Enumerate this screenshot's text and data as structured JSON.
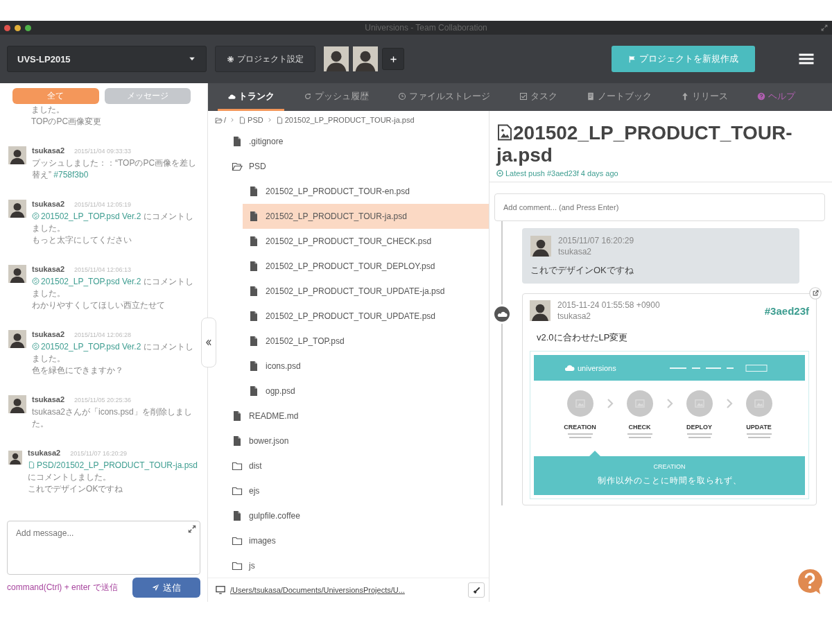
{
  "window": {
    "title": "Universions - Team Collaboration"
  },
  "toolbar": {
    "project": "UVS-LP2015",
    "settings_button": "プロジェクト設定",
    "new_project_button": "プロジェクトを新規作成"
  },
  "feed": {
    "filters": [
      {
        "label": "全て",
        "selected": true
      },
      {
        "label": "メッセージ",
        "selected": false
      }
    ],
    "items": [
      {
        "kind": "partial",
        "parts": [
          {
            "kind": "text",
            "text": "ました。"
          }
        ],
        "note": "TOPのPC画像変更"
      },
      {
        "kind": "entry",
        "user": "tsukasa2",
        "time": "2015/11/04 09:33:33",
        "parts": [
          {
            "kind": "text",
            "text": "プッシュしました：：“TOPのPC画像を差し替え” "
          },
          {
            "kind": "link",
            "text": "#758f3b0"
          }
        ]
      },
      {
        "kind": "entry",
        "user": "tsukasa2",
        "time": "2015/11/04 12:05:19",
        "parts": [
          {
            "kind": "version_link",
            "text": "201502_LP_TOP.psd Ver.2"
          },
          {
            "kind": "text",
            "text": " にコメントしました。"
          }
        ],
        "note": "もっと太字にしてください"
      },
      {
        "kind": "entry",
        "user": "tsukasa2",
        "time": "2015/11/04 12:06:13",
        "parts": [
          {
            "kind": "version_link",
            "text": "201502_LP_TOP.psd Ver.2"
          },
          {
            "kind": "text",
            "text": " にコメントしました。"
          }
        ],
        "note": "わかりやすくしてほしい西立たせて"
      },
      {
        "kind": "entry",
        "user": "tsukasa2",
        "time": "2015/11/04 12:06:28",
        "parts": [
          {
            "kind": "version_link",
            "text": "201502_LP_TOP.psd Ver.2"
          },
          {
            "kind": "text",
            "text": " にコメントしました。"
          }
        ],
        "note": "色を緑色にできますか？"
      },
      {
        "kind": "entry",
        "user": "tsukasa2",
        "time": "2015/11/05 20:25:36",
        "parts": [
          {
            "kind": "text",
            "text": "tsukasa2さんが「icons.psd」を削除しました。"
          }
        ]
      },
      {
        "kind": "entry",
        "user": "tsukasa2",
        "time": "2015/11/07 16:20:29",
        "parts": [
          {
            "kind": "file_link",
            "text": "PSD/201502_LP_PRODUCT_TOUR-ja.psd"
          },
          {
            "kind": "text",
            "text": " にコメントしました。"
          }
        ],
        "note": "これでデザインOKですね"
      }
    ],
    "message": {
      "placeholder": "Add message..."
    },
    "hint": "command(Ctrl) + enter で送信",
    "send_button": "送信"
  },
  "tabs": [
    {
      "label": "トランク",
      "kind": "normal",
      "selected": true
    },
    {
      "label": "プッシュ履歴",
      "kind": "normal",
      "selected": false
    },
    {
      "label": "ファイルストレージ",
      "kind": "normal",
      "selected": false
    },
    {
      "label": "タスク",
      "kind": "normal",
      "selected": false
    },
    {
      "label": "ノートブック",
      "kind": "normal",
      "selected": false
    },
    {
      "label": "リリース",
      "kind": "normal",
      "selected": false
    },
    {
      "label": "ヘルプ",
      "kind": "help",
      "selected": false
    }
  ],
  "breadcrumb": [
    "/",
    "PSD",
    "201502_LP_PRODUCT_TOUR-ja.psd"
  ],
  "tree": [
    {
      "kind": "file",
      "name": ".gitignore",
      "selected": false
    },
    {
      "kind": "folder",
      "name": "PSD",
      "expanded": true,
      "selected": false,
      "children": [
        {
          "kind": "file",
          "name": "201502_LP_PRODUCT_TOUR-en.psd",
          "selected": false
        },
        {
          "kind": "file",
          "name": "201502_LP_PRODUCT_TOUR-ja.psd",
          "selected": true
        },
        {
          "kind": "file",
          "name": "201502_LP_PRODUCT_TOUR_CHECK.psd",
          "selected": false
        },
        {
          "kind": "file",
          "name": "201502_LP_PRODUCT_TOUR_DEPLOY.psd",
          "selected": false
        },
        {
          "kind": "file",
          "name": "201502_LP_PRODUCT_TOUR_UPDATE-ja.psd",
          "selected": false
        },
        {
          "kind": "file",
          "name": "201502_LP_PRODUCT_TOUR_UPDATE.psd",
          "selected": false
        },
        {
          "kind": "file",
          "name": "201502_LP_TOP.psd",
          "selected": false
        },
        {
          "kind": "file",
          "name": "icons.psd",
          "selected": false
        },
        {
          "kind": "file",
          "name": "ogp.psd",
          "selected": false
        }
      ]
    },
    {
      "kind": "file",
      "name": "README.md",
      "selected": false
    },
    {
      "kind": "file",
      "name": "bower.json",
      "selected": false
    },
    {
      "kind": "folder",
      "name": "dist",
      "expanded": false,
      "selected": false
    },
    {
      "kind": "folder",
      "name": "ejs",
      "expanded": false,
      "selected": false
    },
    {
      "kind": "file",
      "name": "gulpfile.coffee",
      "selected": false
    },
    {
      "kind": "folder",
      "name": "images",
      "expanded": false,
      "selected": false
    },
    {
      "kind": "folder",
      "name": "js",
      "expanded": false,
      "selected": false
    }
  ],
  "path": "/Users/tsukasa/Documents/UniversionsProjects/U...",
  "file": {
    "title": "201502_LP_PRODUCT_TOUR-ja.psd",
    "latest_push": "Latest push #3aed23f 4 days ago",
    "comment": {
      "placeholder": "Add comment... (and Press Enter)"
    }
  },
  "timeline": [
    {
      "kind": "comment",
      "time": "2015/11/07 16:20:29",
      "user": "tsukasa2",
      "text": "これでデザインOKですね"
    },
    {
      "kind": "commit",
      "time": "2015-11-24 01:55:58 +0900",
      "user": "tsukasa2",
      "hash": "#3aed23f",
      "message": "v2.0に合わせたLP変更"
    }
  ],
  "preview": {
    "logo": "universions",
    "steps": [
      "CREATION",
      "CHECK",
      "DEPLOY",
      "UPDATE"
    ],
    "panel_title": "CREATION",
    "panel_text": "制作以外のことに時間を取られず、"
  }
}
